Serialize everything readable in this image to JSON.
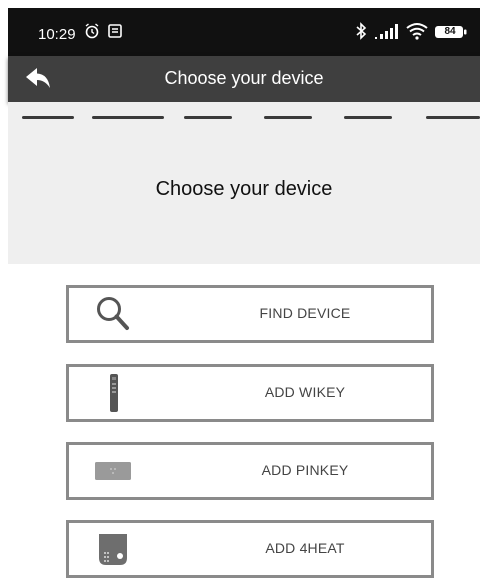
{
  "status_bar": {
    "time": "10:29",
    "battery": "84"
  },
  "app_bar": {
    "title": "Choose your device"
  },
  "content": {
    "title": "Choose your device"
  },
  "options": [
    {
      "label": "FIND DEVICE",
      "icon": "search-icon"
    },
    {
      "label": "ADD WIKEY",
      "icon": "remote-icon"
    },
    {
      "label": "ADD PINKEY",
      "icon": "pinkey-device-icon"
    },
    {
      "label": "ADD 4HEAT",
      "icon": "heater-device-icon"
    }
  ],
  "colors": {
    "status_bar": "#111111",
    "app_bar": "#3f3f3f",
    "content_bg": "#efefef",
    "button_border": "#8a8a8a",
    "button_text": "#444444"
  }
}
